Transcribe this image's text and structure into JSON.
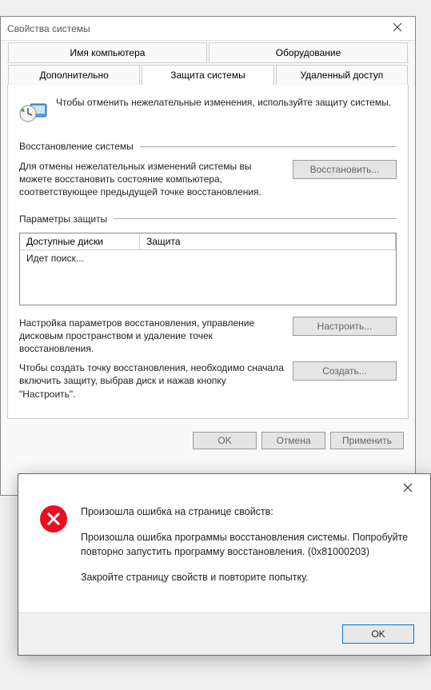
{
  "window": {
    "title": "Свойства системы"
  },
  "tabs": {
    "row1": [
      "Имя компьютера",
      "Оборудование"
    ],
    "row2": [
      "Дополнительно",
      "Защита системы",
      "Удаленный доступ"
    ],
    "active": "Защита системы"
  },
  "intro": "Чтобы отменить нежелательные изменения, используйте защиту системы.",
  "sectionRestore": {
    "title": "Восстановление системы",
    "text": "Для отмены нежелательных изменений системы вы можете восстановить состояние компьютера, соответствующее предыдущей точке восстановления.",
    "button": "Восстановить..."
  },
  "sectionProtect": {
    "title": "Параметры защиты",
    "col1": "Доступные диски",
    "col2": "Защита",
    "searching": "Идет поиск...",
    "configText": "Настройка параметров восстановления, управление дисковым пространством и удаление точек восстановления.",
    "configButton": "Настроить...",
    "createText": "Чтобы создать точку восстановления, необходимо сначала включить защиту, выбрав диск и нажав кнопку \"Настроить\".",
    "createButton": "Создать..."
  },
  "bottom": {
    "ok": "OK",
    "cancel": "Отмена",
    "apply": "Применить"
  },
  "error": {
    "line1": "Произошла ошибка на странице свойств:",
    "line2": "Произошла ошибка программы восстановления системы. Попробуйте повторно запустить программу восстановления. (0x81000203)",
    "line3": "Закройте страницу свойств и повторите попытку.",
    "ok": "OK"
  }
}
